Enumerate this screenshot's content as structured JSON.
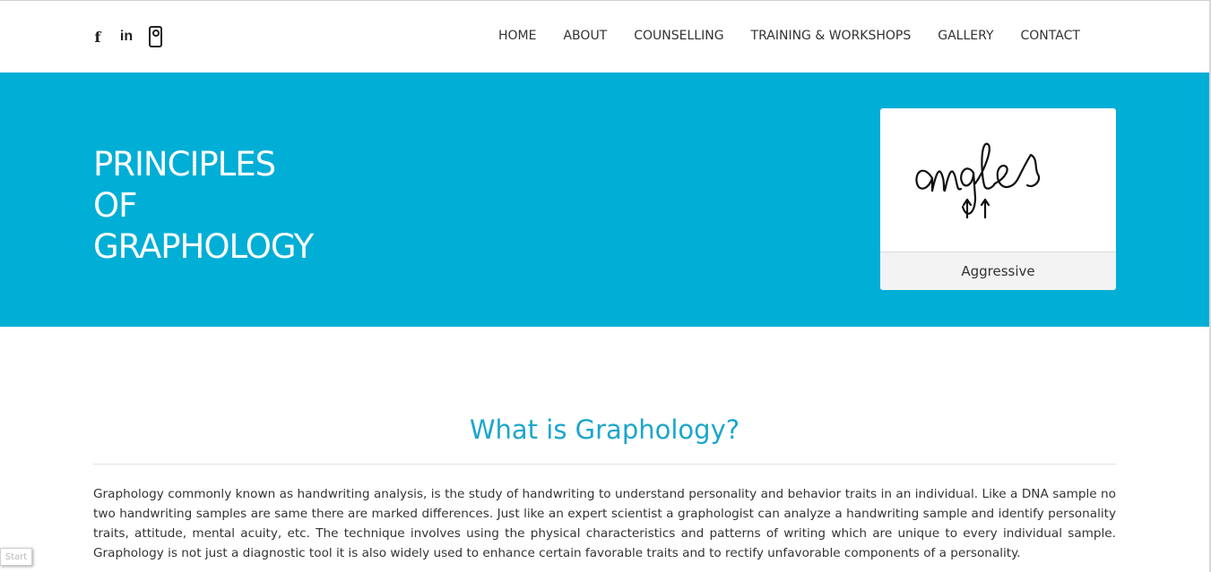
{
  "social": {
    "facebook_icon": "f",
    "linkedin_icon": "in"
  },
  "nav": {
    "items": [
      "HOME",
      "ABOUT",
      "COUNSELLING",
      "TRAINING & WORKSHOPS",
      "GALLERY",
      "CONTACT"
    ]
  },
  "hero": {
    "title_lines": [
      "PRINCIPLES",
      "OF",
      "GRAPHOLOGY"
    ],
    "card": {
      "image_text": "angles",
      "caption": "Aggressive"
    },
    "background_color": "#00aed6"
  },
  "section": {
    "heading": "What is Graphology?",
    "body": "Graphology commonly known as handwriting analysis, is the study of handwriting to understand personality and behavior traits in an individual. Like a DNA sample no two handwriting samples are same there are marked differences. Just like an expert scientist a graphologist can analyze a handwriting sample and identify personality traits, attitude, mental acuity, etc. The technique involves using the physical characteristics and patterns of writing which are unique to every individual sample. Graphology is not just a diagnostic tool it is also widely used to enhance certain favorable traits and to rectify unfavorable components of a personality."
  },
  "widgets": {
    "start_label": "Start"
  }
}
